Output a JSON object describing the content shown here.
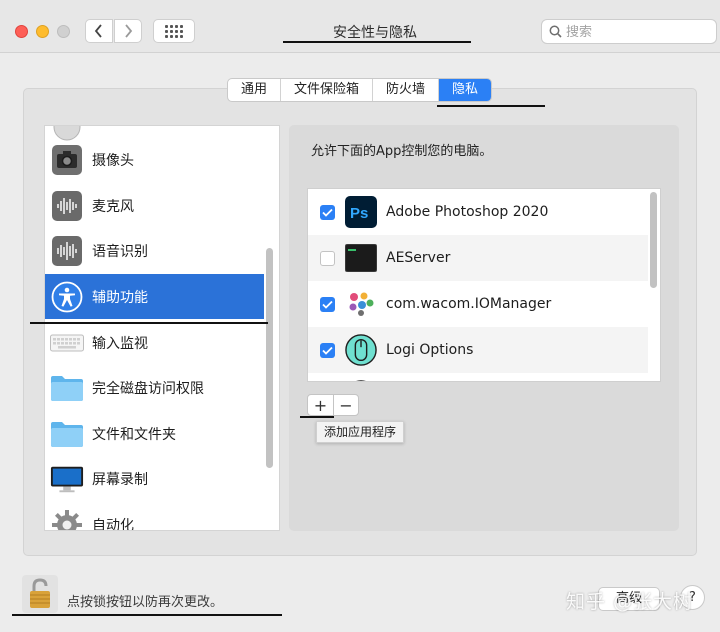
{
  "window": {
    "title": "安全性与隐私",
    "search_placeholder": "搜索"
  },
  "tabs": [
    {
      "label": "通用",
      "active": false
    },
    {
      "label": "文件保险箱",
      "active": false
    },
    {
      "label": "防火墙",
      "active": false
    },
    {
      "label": "隐私",
      "active": true
    }
  ],
  "sidebar": {
    "items": [
      {
        "label": "摄像头",
        "icon": "camera-icon"
      },
      {
        "label": "麦克风",
        "icon": "microphone-icon"
      },
      {
        "label": "语音识别",
        "icon": "speech-recognition-icon"
      },
      {
        "label": "辅助功能",
        "icon": "accessibility-icon",
        "selected": true
      },
      {
        "label": "输入监视",
        "icon": "keyboard-icon"
      },
      {
        "label": "完全磁盘访问权限",
        "icon": "folder-icon"
      },
      {
        "label": "文件和文件夹",
        "icon": "folder-icon"
      },
      {
        "label": "屏幕录制",
        "icon": "display-icon"
      },
      {
        "label": "自动化",
        "icon": "gear-icon"
      }
    ]
  },
  "main": {
    "heading": "允许下面的App控制您的电脑。",
    "apps": [
      {
        "name": "Adobe Photoshop 2020",
        "checked": true,
        "icon": "photoshop-icon"
      },
      {
        "name": "AEServer",
        "checked": false,
        "icon": "terminal-icon"
      },
      {
        "name": "com.wacom.IOManager",
        "checked": true,
        "icon": "wacom-icon"
      },
      {
        "name": "Logi Options",
        "checked": true,
        "icon": "logi-mouse-icon"
      }
    ],
    "add_label": "+",
    "remove_label": "−",
    "tooltip": "添加应用程序"
  },
  "footer": {
    "lock_text": "点按锁按钮以防再次更改。",
    "advanced_label": "高级",
    "help_label": "?",
    "watermark": "知乎 @张大树"
  },
  "colors": {
    "accent": "#2b80f5",
    "selection": "#2b72d8",
    "window_bg": "#ececec"
  }
}
